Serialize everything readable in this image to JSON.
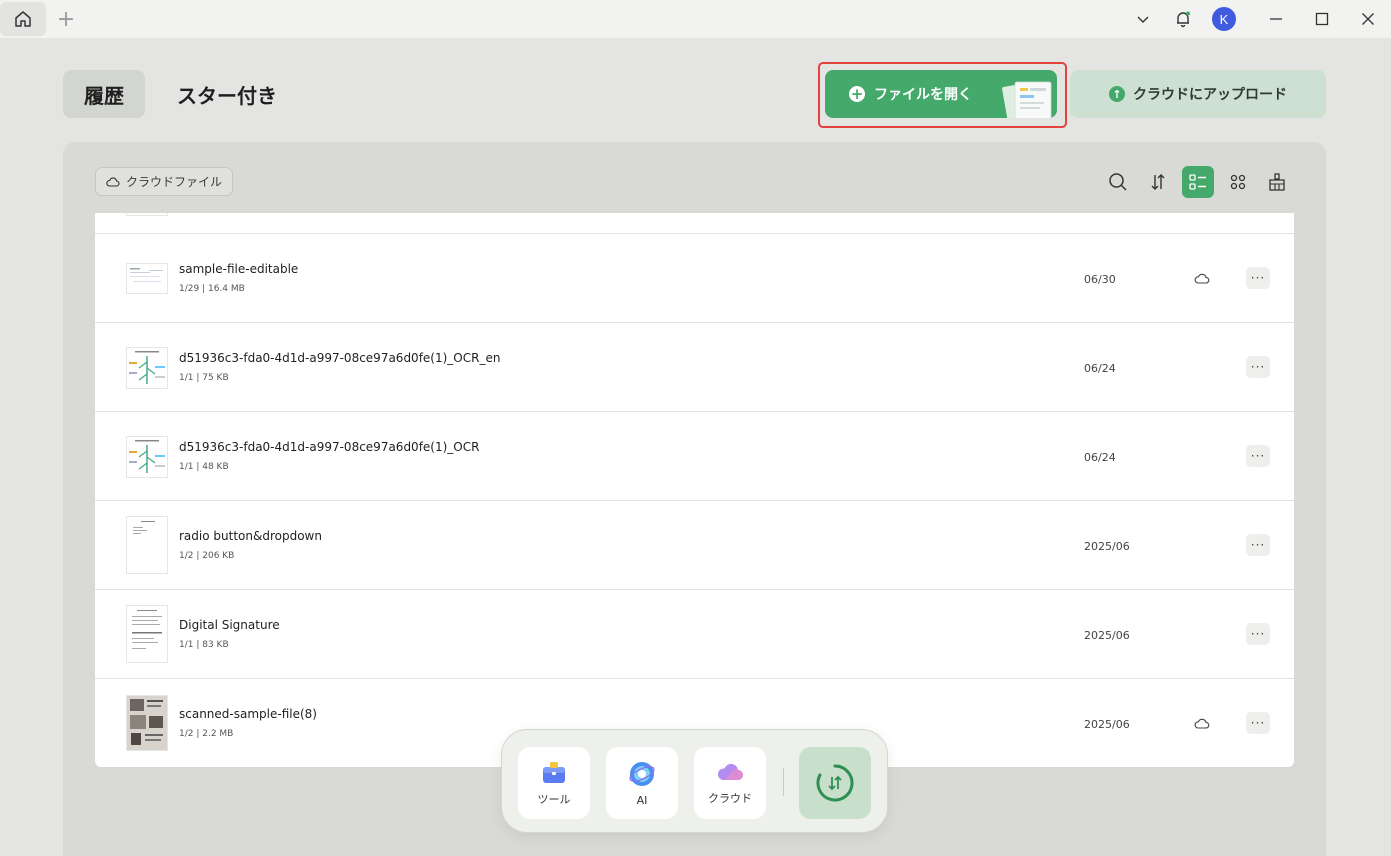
{
  "titlebar": {
    "home_icon": "home-icon",
    "add_tab": "+",
    "avatar_letter": "K"
  },
  "tabs": {
    "history": "履歴",
    "starred": "スター付き"
  },
  "actions": {
    "open_file": "ファイルを開く",
    "upload_cloud": "クラウドにアップロード"
  },
  "panel": {
    "cloud_files_chip": "クラウドファイル"
  },
  "files": [
    {
      "name": "sample-file-editable",
      "meta": "1/29 | 16.4 MB",
      "date": "06/30",
      "cloud": true
    },
    {
      "name": "d51936c3-fda0-4d1d-a997-08ce97a6d0fe(1)_OCR_en",
      "meta": "1/1 | 75 KB",
      "date": "06/24",
      "cloud": false
    },
    {
      "name": "d51936c3-fda0-4d1d-a997-08ce97a6d0fe(1)_OCR",
      "meta": "1/1 | 48 KB",
      "date": "06/24",
      "cloud": false
    },
    {
      "name": "radio button&dropdown",
      "meta": "1/2 | 206 KB",
      "date": "2025/06",
      "cloud": false
    },
    {
      "name": "Digital Signature",
      "meta": "1/1 | 83 KB",
      "date": "2025/06",
      "cloud": false
    },
    {
      "name": "scanned-sample-file(8)",
      "meta": "1/2 | 2.2 MB",
      "date": "2025/06",
      "cloud": true
    }
  ],
  "more_glyph": "···",
  "dock": {
    "tools": "ツール",
    "ai": "AI",
    "cloud": "クラウド"
  },
  "colors": {
    "accent": "#45a96b",
    "highlight": "#e2423c",
    "avatar": "#3f5be0"
  }
}
